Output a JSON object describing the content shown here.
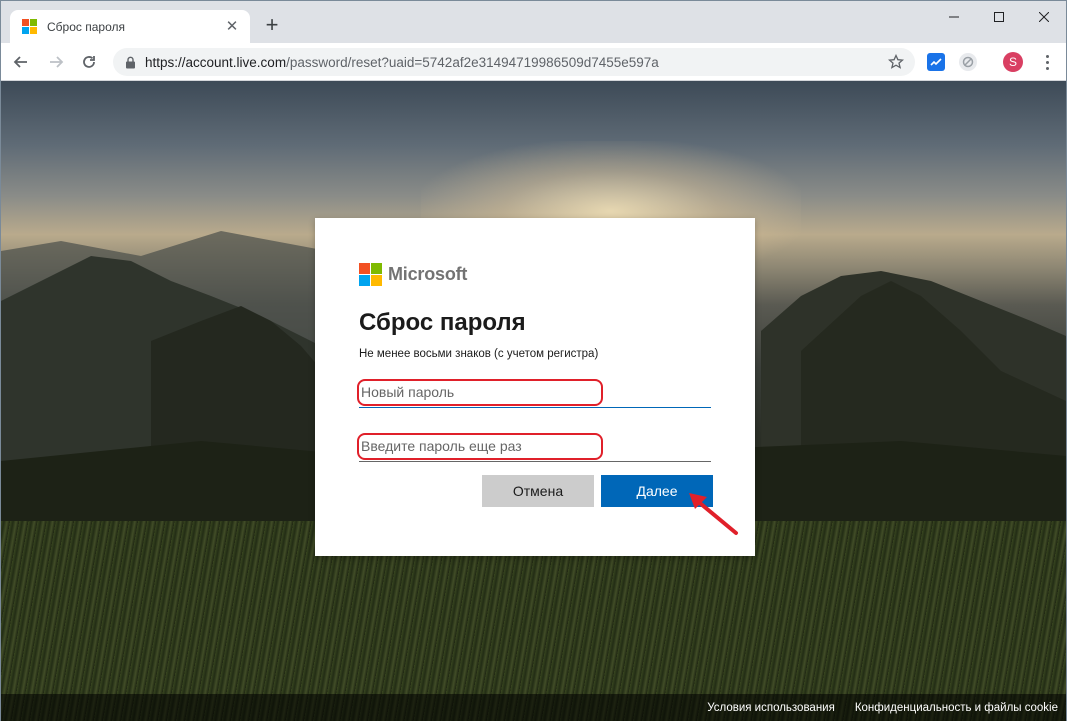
{
  "browser": {
    "tab": {
      "title": "Сброс пароля"
    },
    "new_tab_symbol": "+",
    "url": {
      "host": "https://account.live.com",
      "path": "/password/reset?uaid=5742af2e31494719986509d7455e597a"
    },
    "profile_initial": "S"
  },
  "dialog": {
    "brand": "Microsoft",
    "title": "Сброс пароля",
    "description": "Не менее восьми знаков (с учетом регистра)",
    "new_password_placeholder": "Новый пароль",
    "confirm_password_placeholder": "Введите пароль еще раз",
    "cancel_label": "Отмена",
    "next_label": "Далее"
  },
  "footer": {
    "terms": "Условия использования",
    "privacy": "Конфиденциальность и файлы cookie"
  },
  "colors": {
    "ms_red": "#f25022",
    "ms_green": "#7fba00",
    "ms_blue": "#00a4ef",
    "ms_yellow": "#ffb900",
    "primary_button": "#0067b8",
    "annotation": "#e0202a"
  },
  "icons": {
    "back": "arrow-left-icon",
    "forward": "arrow-right-icon",
    "reload": "reload-icon",
    "lock": "lock-icon",
    "bookmark": "star-icon",
    "menu": "more-vert-icon"
  }
}
